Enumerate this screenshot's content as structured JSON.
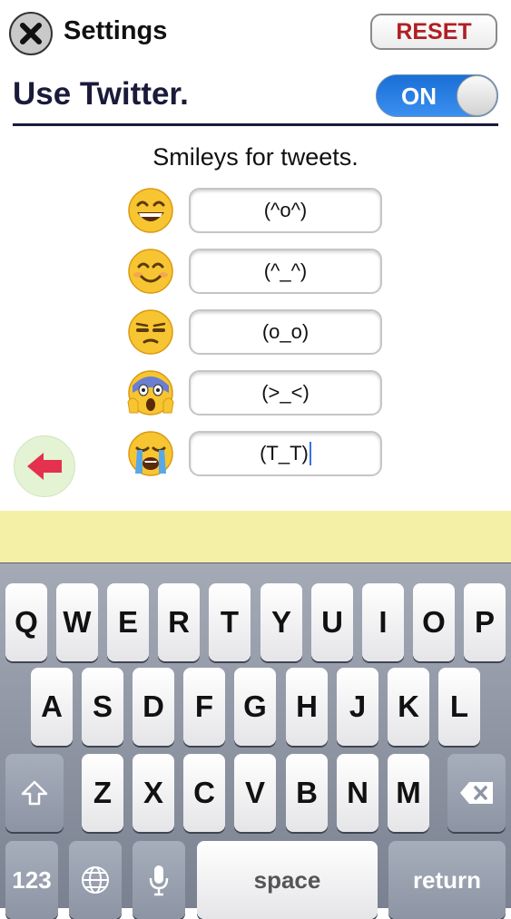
{
  "header": {
    "title": "Settings",
    "reset_label": "RESET"
  },
  "twitter": {
    "label": "Use Twitter.",
    "toggle_label": "ON",
    "toggle_on": true,
    "accent": "#1a6fd6"
  },
  "smileys": {
    "title": "Smileys for tweets.",
    "items": [
      {
        "emoji": "grinning-face",
        "value": "(^o^)"
      },
      {
        "emoji": "smiling-face",
        "value": "(^_^)"
      },
      {
        "emoji": "unamused-face",
        "value": "(o_o)"
      },
      {
        "emoji": "screaming-face",
        "value": "(>_<)"
      },
      {
        "emoji": "crying-face",
        "value": "(T_T)"
      }
    ]
  },
  "keyboard": {
    "row1": [
      "Q",
      "W",
      "E",
      "R",
      "T",
      "Y",
      "U",
      "I",
      "O",
      "P"
    ],
    "row2": [
      "A",
      "S",
      "D",
      "F",
      "G",
      "H",
      "J",
      "K",
      "L"
    ],
    "row3": [
      "Z",
      "X",
      "C",
      "V",
      "B",
      "N",
      "M"
    ],
    "numbers_label": "123",
    "space_label": "space",
    "return_label": "return"
  }
}
